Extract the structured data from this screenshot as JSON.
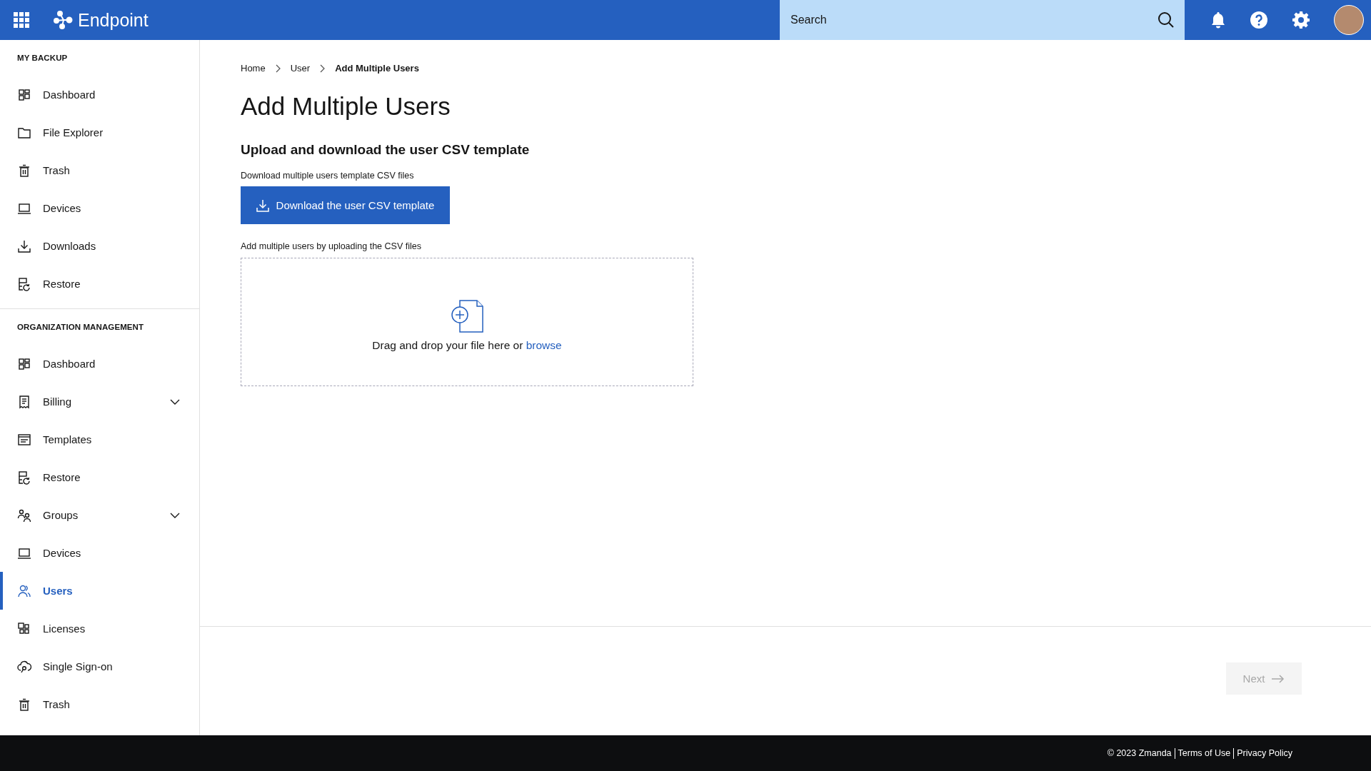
{
  "header": {
    "brand": "Endpoint",
    "search": {
      "placeholder": "Search"
    }
  },
  "sidebar": {
    "sections": [
      {
        "title": "MY BACKUP",
        "items": [
          {
            "label": "Dashboard",
            "kind": "link",
            "selected": false
          },
          {
            "label": "File Explorer",
            "kind": "link",
            "selected": false
          },
          {
            "label": "Trash",
            "kind": "link",
            "selected": false
          },
          {
            "label": "Devices",
            "kind": "link",
            "selected": false
          },
          {
            "label": "Downloads",
            "kind": "link",
            "selected": false
          },
          {
            "label": "Restore",
            "kind": "link",
            "selected": false
          }
        ]
      },
      {
        "title": "ORGANIZATION MANAGEMENT",
        "items": [
          {
            "label": "Dashboard",
            "kind": "link",
            "selected": false
          },
          {
            "label": "Billing",
            "kind": "group",
            "expanded": false,
            "selected": false
          },
          {
            "label": "Templates",
            "kind": "link",
            "selected": false
          },
          {
            "label": "Restore",
            "kind": "link",
            "selected": false
          },
          {
            "label": "Groups",
            "kind": "group",
            "expanded": false,
            "selected": false
          },
          {
            "label": "Devices",
            "kind": "link",
            "selected": false
          },
          {
            "label": "Users",
            "kind": "link",
            "selected": true
          },
          {
            "label": "Licenses",
            "kind": "link",
            "selected": false
          },
          {
            "label": "Single Sign-on",
            "kind": "link",
            "selected": false
          },
          {
            "label": "Trash",
            "kind": "link",
            "selected": false
          }
        ]
      }
    ]
  },
  "breadcrumb": [
    {
      "label": "Home",
      "current": false
    },
    {
      "label": "User",
      "current": false
    },
    {
      "label": "Add Multiple Users",
      "current": true
    }
  ],
  "page_title": "Add Multiple Users",
  "section_title": "Upload and download the user CSV template",
  "download_label": "Download multiple users template CSV files",
  "download_button": "Download the user CSV template",
  "upload_label": "Add multiple users by uploading the CSV files",
  "dropzone": {
    "text": "Drag and drop your file here or ",
    "link": "browse"
  },
  "next_button": {
    "label": "Next",
    "disabled": true
  },
  "footer": [
    "© 2023 Zmanda",
    "Terms of Use",
    "Privacy Policy"
  ]
}
